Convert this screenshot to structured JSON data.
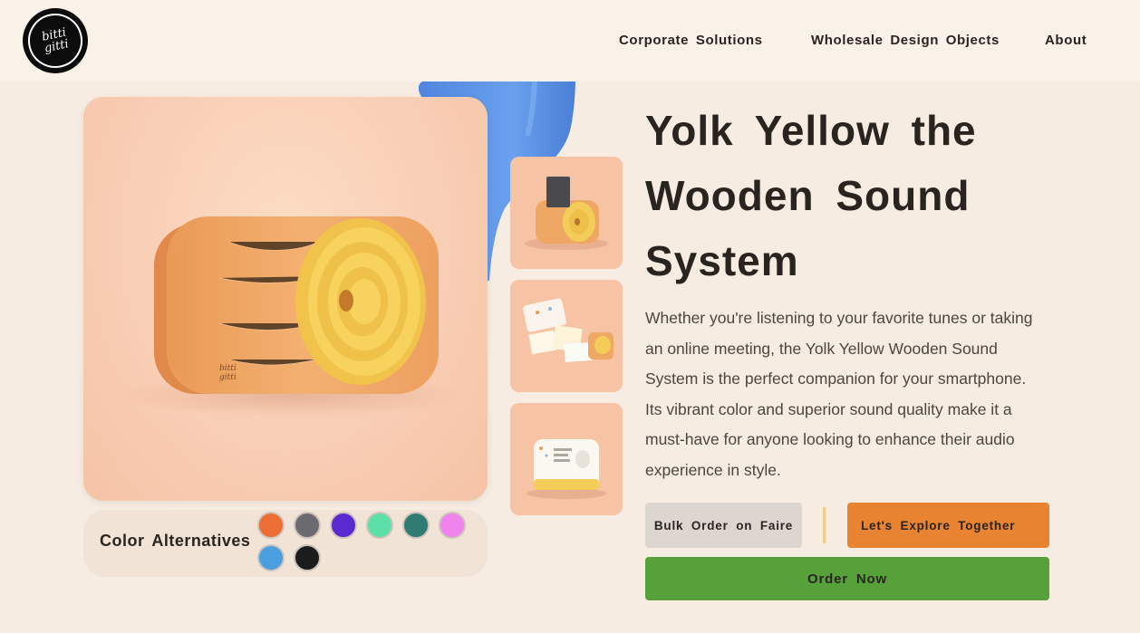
{
  "brand": {
    "logo_line1": "bitti",
    "logo_line2": "gitti"
  },
  "nav": {
    "items": [
      {
        "label": "Corporate Solutions"
      },
      {
        "label": "Wholesale Design Objects"
      },
      {
        "label": "About"
      }
    ]
  },
  "product": {
    "title": "Yolk Yellow the Wooden Sound System",
    "description": "Whether you're listening to your favorite tunes or taking an online meeting, the Yolk Yellow Wooden Sound System is the perfect companion for your smartphone. Its vibrant color and superior sound quality make it a must-have for anyone looking to enhance their audio experience in style.",
    "engraving": "bitti gitti"
  },
  "colors": {
    "label": "Color Alternatives",
    "swatches": [
      "#ec6e35",
      "#6b6a6f",
      "#5a2ad0",
      "#5cdfa8",
      "#2f7a71",
      "#ee84ec",
      "#4a9fe0",
      "#1c1c1c"
    ]
  },
  "actions": {
    "bulk_label": "Bulk Order on Faire",
    "explore_label": "Let's Explore Together",
    "order_label": "Order Now"
  },
  "theme": {
    "background": "#f7ece1",
    "accent_orange": "#e88331",
    "accent_green": "#57a13b",
    "blob_blue": "#5b93e6"
  }
}
